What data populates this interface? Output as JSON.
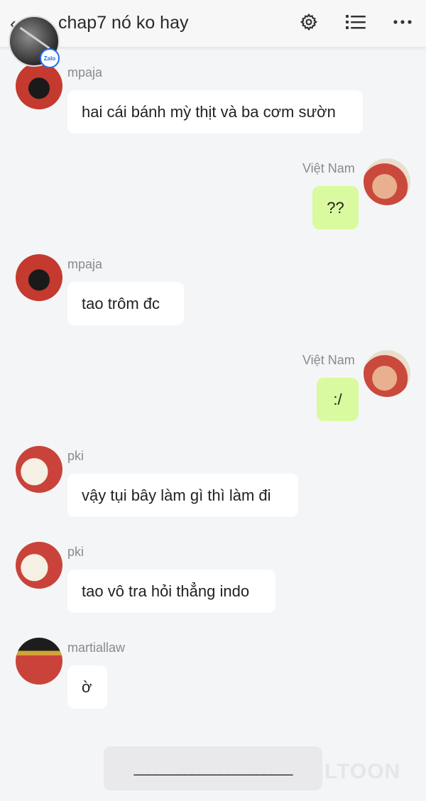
{
  "header": {
    "title": "chap7 nó ko hay",
    "badge": "Zalo",
    "icons": [
      "back-chevron-icon",
      "gear-icon",
      "list-icon",
      "more-dots-icon"
    ]
  },
  "messages": [
    {
      "sender": "mpaja",
      "text": "hai cái bánh mỳ thịt và ba cơm sườn"
    },
    {
      "sender": "Việt Nam",
      "text": "??"
    },
    {
      "sender": "mpaja",
      "text": "tao trôm đc"
    },
    {
      "sender": "Việt Nam",
      "text": ":/"
    },
    {
      "sender": "pki",
      "text": "vậy tụi bây làm gì thì làm đi"
    },
    {
      "sender": "pki",
      "text": "tao vô tra hỏi thẳng indo"
    },
    {
      "sender": "martiallaw",
      "text": "ờ"
    }
  ],
  "composer": {
    "text": "______________________"
  },
  "watermark": "ELTOON",
  "colors": {
    "own_bubble": "#d9fa9e",
    "other_bubble": "#ffffff",
    "background": "#f4f5f7"
  }
}
